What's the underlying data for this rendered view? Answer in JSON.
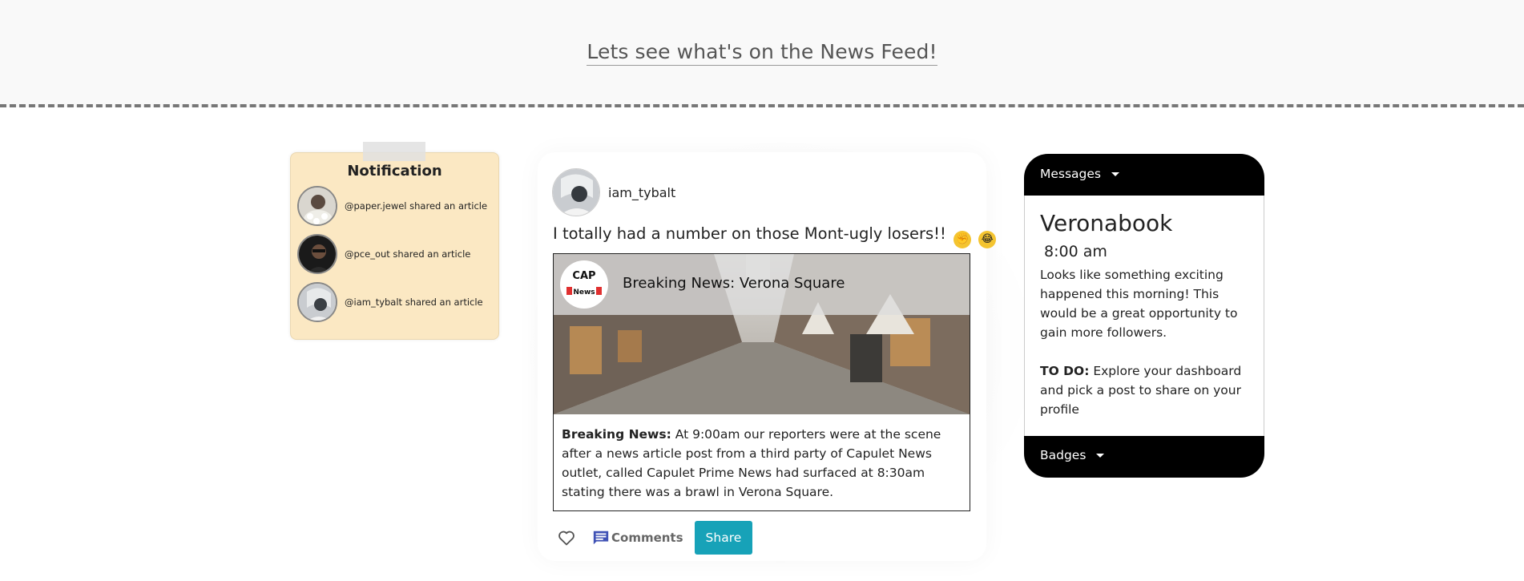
{
  "header": {
    "title": "Lets see what's on the News Feed!"
  },
  "notifications": {
    "title": "Notification",
    "items": [
      {
        "text": "@paper.jewel shared an article"
      },
      {
        "text": "@pce_out shared an article"
      },
      {
        "text": "@iam_tybalt shared an article"
      }
    ]
  },
  "post": {
    "username": "iam_tybalt",
    "caption": "I totally had a number on those Mont-ugly losers!!",
    "article": {
      "logo_top": "CAP",
      "logo_bottom": "News",
      "title": "Breaking News: Verona Square",
      "body_label": "Breaking News:",
      "body_text": "At 9:00am our reporters were at the scene after a news article post from a third party of Capulet News outlet, called Capulet Prime News had surfaced at 8:30am stating there was a brawl in Verona Square."
    },
    "actions": {
      "comments_label": "Comments",
      "share_label": "Share"
    }
  },
  "messages": {
    "header_label": "Messages",
    "brand": "Veronabook",
    "time": "8:00 am",
    "description": "Looks like something exciting happened this morning! This would be a great opportunity to gain more followers.",
    "todo_label": "TO DO:",
    "todo_text": "Explore your dashboard and pick a post to share on your profile",
    "footer_label": "Badges"
  },
  "colors": {
    "notification_bg": "#fbe8c3",
    "share_button": "#17a2b8",
    "card_header": "#000000",
    "comments_icon": "#3f51b5"
  }
}
